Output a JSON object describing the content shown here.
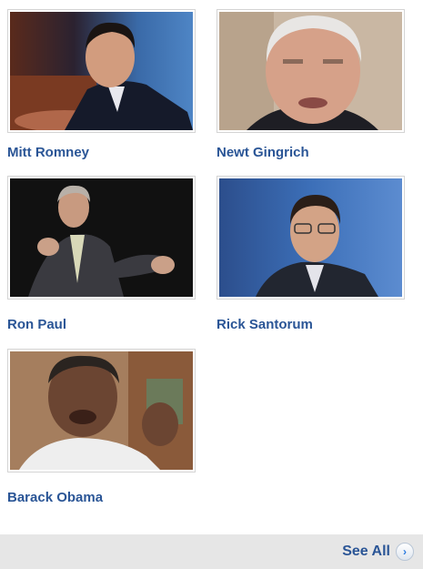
{
  "candidates": [
    {
      "name": "Mitt Romney",
      "photo": "mitt-romney-photo"
    },
    {
      "name": "Newt Gingrich",
      "photo": "newt-gingrich-photo"
    },
    {
      "name": "Ron Paul",
      "photo": "ron-paul-photo"
    },
    {
      "name": "Rick Santorum",
      "photo": "rick-santorum-photo"
    },
    {
      "name": "Barack Obama",
      "photo": "barack-obama-photo"
    }
  ],
  "footer": {
    "see_all_label": "See All",
    "arrow_icon": "chevron-right-icon"
  },
  "colors": {
    "link": "#2a5596",
    "footer_bg": "#e6e6e6",
    "arrow": "#2a7be0"
  }
}
